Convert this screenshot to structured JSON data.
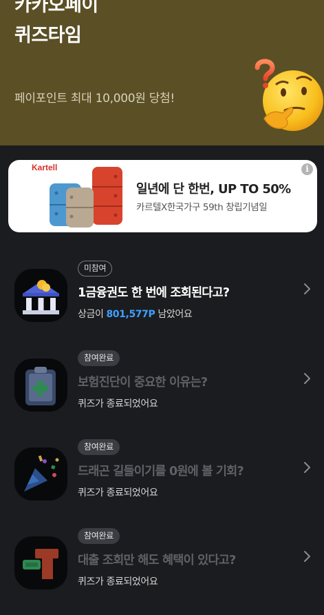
{
  "hero": {
    "title_line1": "카카오페이",
    "title_line2": "퀴즈타임",
    "subtitle": "페이포인트 최대 10,000원 당첨!",
    "background": "#5a4f25"
  },
  "ad": {
    "brand": "Kartell",
    "title": "일년에 단 한번, UP TO 50%",
    "description": "카르텔X한국가구 59th 창립기념일",
    "info_icon": "i"
  },
  "quizzes": [
    {
      "badge": "미참여",
      "title": "1금융권도 한 번에 조회된다고?",
      "status_prefix": "상금이 ",
      "prize": "801,577P",
      "status_suffix": " 남았어요",
      "icon": "bank-icon",
      "active": true
    },
    {
      "badge": "참여완료",
      "title": "보험진단이 중요한 이유는?",
      "status": "퀴즈가 종료되었어요",
      "icon": "medical-clipboard-icon",
      "active": false
    },
    {
      "badge": "참여완료",
      "title": "드래곤 길들이기를 0원에 볼 기회?",
      "status": "퀴즈가 종료되었어요",
      "icon": "party-popper-icon",
      "active": false
    },
    {
      "badge": "참여완료",
      "title": "대출 조회만 해도 혜택이 있다고?",
      "status": "퀴즈가 종료되었어요",
      "icon": "loan-icon",
      "active": false
    }
  ],
  "colors": {
    "accent_blue": "#3fa0ff",
    "background": "#1b1c1f",
    "muted_text": "#5f6166"
  }
}
